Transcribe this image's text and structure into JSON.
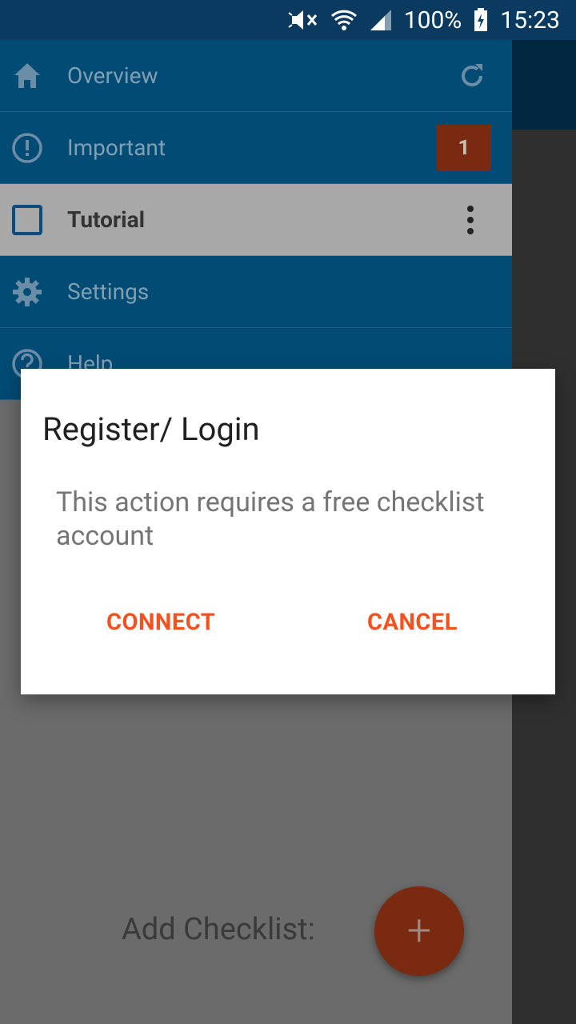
{
  "status_bar": {
    "battery": "100%",
    "time": "15:23"
  },
  "drawer": {
    "items": [
      {
        "label": "Overview",
        "icon": "home-icon",
        "right": "refresh-icon"
      },
      {
        "label": "Important",
        "icon": "alert-circle-icon",
        "badge": "1"
      },
      {
        "label": "Tutorial",
        "icon": "checkbox-icon",
        "right": "more-vert-icon"
      },
      {
        "label": "Settings",
        "icon": "gear-icon"
      },
      {
        "label": "Help",
        "icon": "help-icon"
      }
    ]
  },
  "main": {
    "add_label": "Add Checklist:",
    "fab_symbol": "+"
  },
  "dialog": {
    "title": "Register/ Login",
    "message": "This action requires a free checklist account",
    "connect_label": "CONNECT",
    "cancel_label": "CANCEL"
  },
  "colors": {
    "accent": "#f4511e",
    "status_bar": "#0a3a60",
    "drawer_item": "#024b75"
  }
}
